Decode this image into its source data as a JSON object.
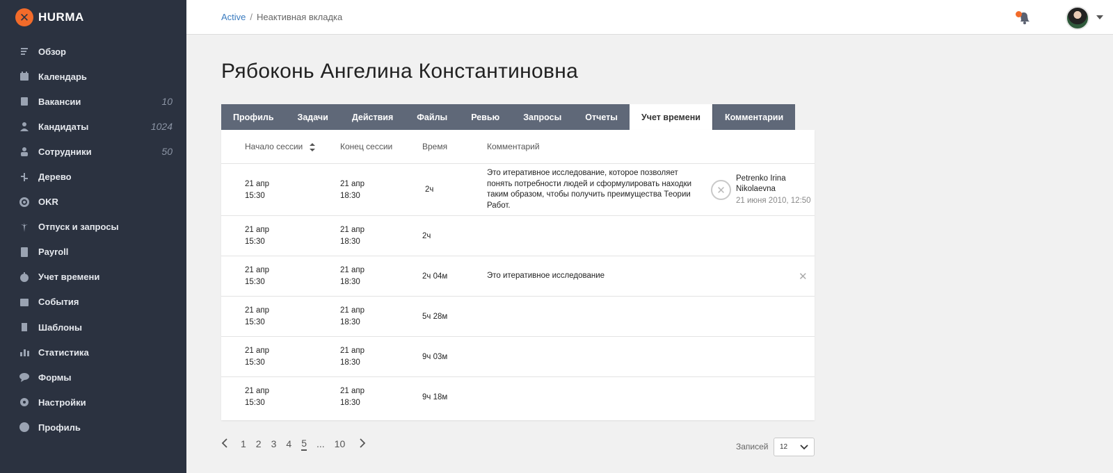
{
  "app": {
    "logo_text": "HURMA"
  },
  "sidebar": {
    "items": [
      {
        "label": "Обзор",
        "icon": "overview-icon",
        "count": ""
      },
      {
        "label": "Календарь",
        "icon": "calendar-icon",
        "count": ""
      },
      {
        "label": "Вакансии",
        "icon": "vacancies-icon",
        "count": "10"
      },
      {
        "label": "Кандидаты",
        "icon": "candidate-icon",
        "count": "1024"
      },
      {
        "label": "Сотрудники",
        "icon": "employee-icon",
        "count": "50"
      },
      {
        "label": "Дерево",
        "icon": "tree-icon",
        "count": ""
      },
      {
        "label": "OKR",
        "icon": "target-icon",
        "count": ""
      },
      {
        "label": "Отпуск и запросы",
        "icon": "palm-icon",
        "count": ""
      },
      {
        "label": "Payroll",
        "icon": "calculator-icon",
        "count": ""
      },
      {
        "label": "Учет времени",
        "icon": "stopwatch-icon",
        "count": ""
      },
      {
        "label": "События",
        "icon": "event-icon",
        "count": ""
      },
      {
        "label": "Шаблоны",
        "icon": "templates-icon",
        "count": ""
      },
      {
        "label": "Статистика",
        "icon": "stats-icon",
        "count": ""
      },
      {
        "label": "Формы",
        "icon": "chat-icon",
        "count": ""
      },
      {
        "label": "Настройки",
        "icon": "gear-icon",
        "count": ""
      },
      {
        "label": "Профиль",
        "icon": "profile-icon",
        "count": ""
      }
    ]
  },
  "header": {
    "breadcrumb_active": "Active",
    "breadcrumb_separator": "/",
    "breadcrumb_current": "Неактивная вкладка"
  },
  "page": {
    "title": "Рябоконь Ангелина Константиновна"
  },
  "tabs": [
    {
      "label": "Профиль",
      "active": false
    },
    {
      "label": "Задачи",
      "active": false
    },
    {
      "label": "Действия",
      "active": false
    },
    {
      "label": "Файлы",
      "active": false
    },
    {
      "label": "Ревью",
      "active": false
    },
    {
      "label": "Запросы",
      "active": false
    },
    {
      "label": "Отчеты",
      "active": false
    },
    {
      "label": "Учет времени",
      "active": true
    },
    {
      "label": "Комментарии",
      "active": false
    }
  ],
  "table": {
    "columns": {
      "start": "Начало сессии",
      "end": "Конец сессии",
      "time": "Время",
      "comment": "Комментарий"
    },
    "rows": [
      {
        "start_date": "21 апр",
        "start_time": "15:30",
        "end_date": "21 апр",
        "end_time": "18:30",
        "duration": "2ч",
        "comment": "Это итеративное исследование, которое позволяет понять потребности людей и сформулировать находки таким образом, чтобы получить преимущества Теории Работ.",
        "author": "Petrenko Irina Nikolaevna",
        "author_date": "21 июня 2010, 12:50"
      },
      {
        "start_date": "21 апр",
        "start_time": "15:30",
        "end_date": "21 апр",
        "end_time": "18:30",
        "duration": "2ч",
        "comment": "",
        "author": "",
        "author_date": ""
      },
      {
        "start_date": "21 апр",
        "start_time": "15:30",
        "end_date": "21 апр",
        "end_time": "18:30",
        "duration": "2ч 04м",
        "comment": "Это итеративное исследование",
        "author": "",
        "author_date": ""
      },
      {
        "start_date": "21 апр",
        "start_time": "15:30",
        "end_date": "21 апр",
        "end_time": "18:30",
        "duration": "5ч 28м",
        "comment": "",
        "author": "",
        "author_date": ""
      },
      {
        "start_date": "21 апр",
        "start_time": "15:30",
        "end_date": "21 апр",
        "end_time": "18:30",
        "duration": "9ч 03м",
        "comment": "",
        "author": "",
        "author_date": ""
      },
      {
        "start_date": "21 апр",
        "start_time": "15:30",
        "end_date": "21 апр",
        "end_time": "18:30",
        "duration": "9ч 18м",
        "comment": "",
        "author": "",
        "author_date": ""
      }
    ]
  },
  "pagination": {
    "pages": [
      "1",
      "2",
      "3",
      "4",
      "5",
      "...",
      "10"
    ],
    "current": "5",
    "records_label": "Записей",
    "records_value": "12"
  },
  "colors": {
    "sidebar_bg": "#2b3240",
    "accent": "#f26b2a",
    "tab_bg": "#5f6878",
    "link": "#3a7bbf"
  }
}
